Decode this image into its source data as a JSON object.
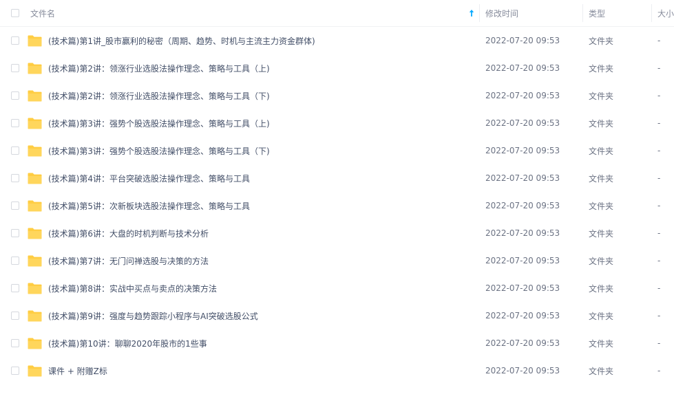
{
  "header": {
    "name": "文件名",
    "modified": "修改时间",
    "type": "类型",
    "size": "大小"
  },
  "colors": {
    "folder": "#ffcd43",
    "sort_arrow": "#09aaff",
    "text": "#424e67",
    "muted": "#878c9c"
  },
  "rows": [
    {
      "name": "(技术篇)第1讲_股市赢利的秘密（周期、趋势、时机与主流主力资金群体)",
      "modified": "2022-07-20 09:53",
      "type": "文件夹",
      "size": "-"
    },
    {
      "name": "(技术篇)第2讲：领涨行业选股法操作理念、策略与工具（上)",
      "modified": "2022-07-20 09:53",
      "type": "文件夹",
      "size": "-"
    },
    {
      "name": "(技术篇)第2讲：领涨行业选股法操作理念、策略与工具（下)",
      "modified": "2022-07-20 09:53",
      "type": "文件夹",
      "size": "-"
    },
    {
      "name": "(技术篇)第3讲：强势个股选股法操作理念、策略与工具（上)",
      "modified": "2022-07-20 09:53",
      "type": "文件夹",
      "size": "-"
    },
    {
      "name": "(技术篇)第3讲：强势个股选股法操作理念、策略与工具（下)",
      "modified": "2022-07-20 09:53",
      "type": "文件夹",
      "size": "-"
    },
    {
      "name": "(技术篇)第4讲：平台突破选股法操作理念、策略与工具",
      "modified": "2022-07-20 09:53",
      "type": "文件夹",
      "size": "-"
    },
    {
      "name": "(技术篇)第5讲：次新板块选股法操作理念、策略与工具",
      "modified": "2022-07-20 09:53",
      "type": "文件夹",
      "size": "-"
    },
    {
      "name": "(技术篇)第6讲：大盘的时机判断与技术分析",
      "modified": "2022-07-20 09:53",
      "type": "文件夹",
      "size": "-"
    },
    {
      "name": "(技术篇)第7讲：无门问禅选股与决策的方法",
      "modified": "2022-07-20 09:53",
      "type": "文件夹",
      "size": "-"
    },
    {
      "name": "(技术篇)第8讲：实战中买点与卖点的决策方法",
      "modified": "2022-07-20 09:53",
      "type": "文件夹",
      "size": "-"
    },
    {
      "name": "(技术篇)第9讲：强度与趋势跟踪小程序与AI突破选股公式",
      "modified": "2022-07-20 09:53",
      "type": "文件夹",
      "size": "-"
    },
    {
      "name": "(技术篇)第10讲：聊聊2020年股市的1些事",
      "modified": "2022-07-20 09:53",
      "type": "文件夹",
      "size": "-"
    },
    {
      "name": "课件 + 附赠Z标",
      "modified": "2022-07-20 09:53",
      "type": "文件夹",
      "size": "-"
    }
  ]
}
